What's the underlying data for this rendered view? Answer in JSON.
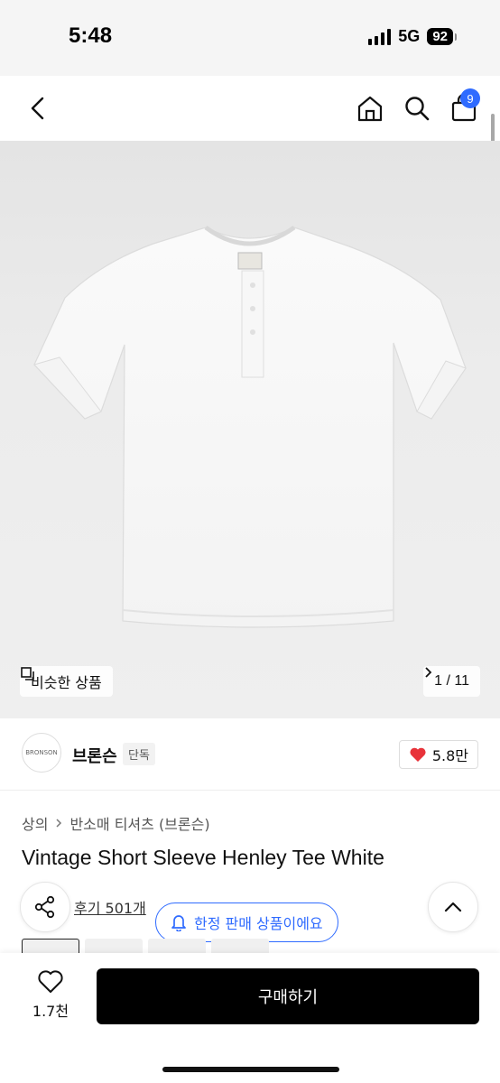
{
  "status": {
    "time": "5:48",
    "network": "5G",
    "battery": "92"
  },
  "nav": {
    "cart_count": "9"
  },
  "gallery": {
    "similar_label": "비슷한 상품",
    "pager": "1 / 11",
    "product_image": "white-henley-tee"
  },
  "brand": {
    "logo_text": "BRONSON",
    "name": "브론슨",
    "tag": "단독",
    "likes": "5.8만"
  },
  "product": {
    "breadcrumb": [
      "상의",
      "반소매 티셔츠 (브론슨)"
    ],
    "title": "Vintage Short Sleeve Henley Tee White",
    "reviews": "후기 501개",
    "limited_notice": "한정 판매 상품이에요"
  },
  "bottom": {
    "wish_count": "1.7천",
    "buy_label": "구매하기"
  },
  "colors": {
    "accent": "#2f6bff",
    "like": "#e8333a",
    "buy_bg": "#000000"
  },
  "icons": [
    "back-icon",
    "home-icon",
    "search-icon",
    "bag-icon",
    "similar-icon",
    "chevron-right-icon",
    "heart-icon",
    "share-icon",
    "bell-icon",
    "chevron-up-icon"
  ]
}
